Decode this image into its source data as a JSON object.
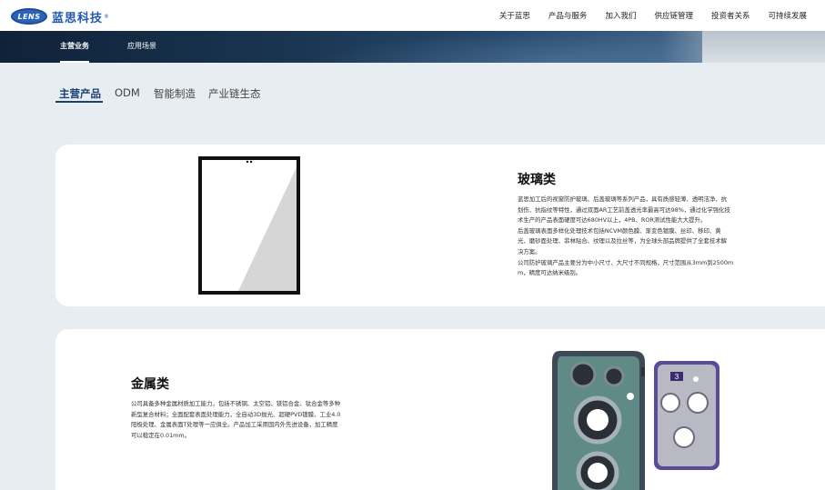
{
  "brand": {
    "logo_text": "LENS",
    "name": "蓝思科技",
    "reg_mark": "®",
    "colors": {
      "brand_blue": "#1f57ad",
      "dark_navy": "#1b3f72",
      "banner_dark": "#0f2238"
    }
  },
  "nav": {
    "items": [
      {
        "label": "关于蓝思"
      },
      {
        "label": "产品与服务"
      },
      {
        "label": "加入我们"
      },
      {
        "label": "供应链管理"
      },
      {
        "label": "投资者关系"
      },
      {
        "label": "可持续发展"
      }
    ]
  },
  "subnav": {
    "items": [
      {
        "label": "主营业务",
        "active": true
      },
      {
        "label": "应用场景",
        "active": false
      }
    ]
  },
  "category_tabs": {
    "items": [
      {
        "label": "主营产品",
        "active": true
      },
      {
        "label": "ODM",
        "active": false
      },
      {
        "label": "智能制造",
        "active": false
      },
      {
        "label": "产业链生态",
        "active": false
      }
    ]
  },
  "products": [
    {
      "title": "玻璃类",
      "image": "glass-panel",
      "desc_lines": [
        "蓝思加工后的视窗防护玻璃、后盖玻璃等系列产品，具有质感轻薄、透明洁净、抗",
        "划伤、抗指纹等特性，通过双面AR工艺前盖透光率最高可达98%，通过化学强化技",
        "术生产的产品表面硬度可达680HV以上，4PB、ROR测试性能大大提升。",
        "后盖玻璃表面多样化处理技术包括NCVM颜色膜、渐变色镀膜、丝印、移印、黄",
        "光、磨砂面处理、菲林贴合、纹理以及拉丝等，为全球头部品牌提供了全套技术解",
        "决方案。",
        "公司防护玻璃产品主要分为中小尺寸、大尺寸不同规格，尺寸范围从3mm到2500m",
        "m，精度可达纳米级别。"
      ]
    },
    {
      "title": "金属类",
      "image": "metal-camera-frames",
      "badge": "3",
      "desc_lines": [
        "公司具备多种金属材质加工能力，包括不锈钢、太空铝、镁铝合金、钛合金等多种",
        "新型复合材料；全面配套表面处理能力，全自动3D抛光、超硬PVD镀膜、工业4.0",
        "阳极处理、金属表面T处理等一应俱全。产品加工采用国内外先进设备，加工精度",
        "可以稳定在0.01mm。"
      ]
    }
  ]
}
